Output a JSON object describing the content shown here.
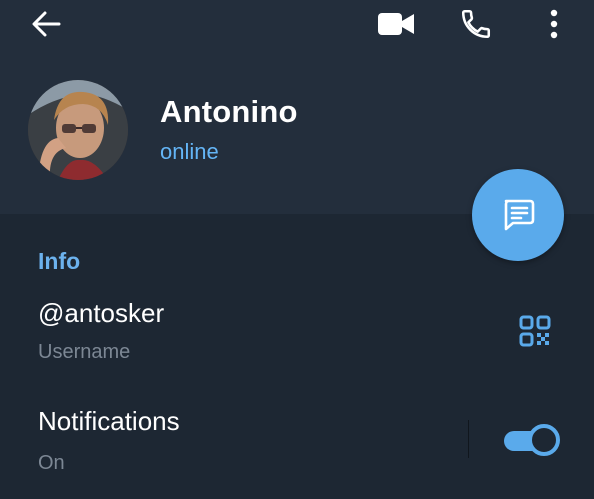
{
  "header": {
    "back_icon": "arrow-left-icon",
    "video_icon": "video-camera-icon",
    "call_icon": "phone-icon",
    "more_icon": "more-vertical-icon"
  },
  "profile": {
    "name": "Antonino",
    "status": "online",
    "status_color": "#64b5f6"
  },
  "fab": {
    "icon": "message-icon",
    "color": "#5aaaeb"
  },
  "info": {
    "section_title": "Info",
    "username": {
      "value": "@antosker",
      "caption": "Username",
      "action_icon": "qr-code-icon"
    },
    "notifications": {
      "value": "Notifications",
      "caption": "On",
      "enabled": true
    }
  },
  "colors": {
    "background": "#1d2733",
    "header_background": "#232e3c",
    "accent": "#5aaaeb",
    "caption": "#7c8794"
  }
}
